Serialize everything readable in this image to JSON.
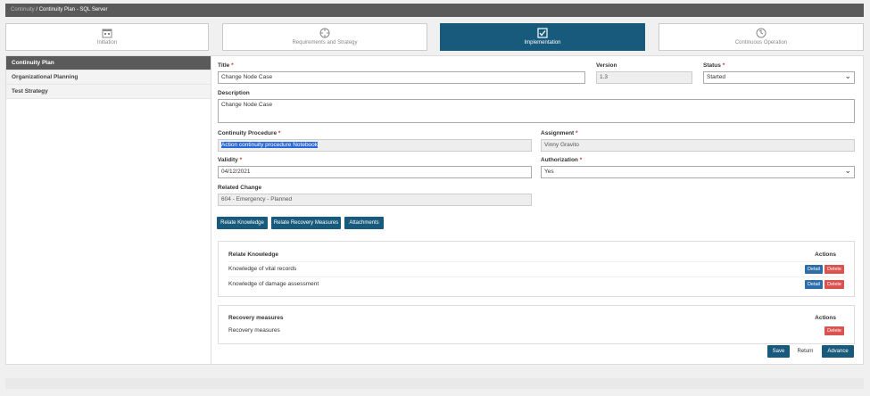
{
  "breadcrumb": {
    "parent": "Continuity",
    "separator": "/",
    "current": "Continuity Plan - SQL Server"
  },
  "steps": [
    {
      "label": "Initiation",
      "icon": "calendar-icon"
    },
    {
      "label": "Requirements and Strategy",
      "icon": "crosshair-icon"
    },
    {
      "label": "Implementation",
      "icon": "checkbox-icon"
    },
    {
      "label": "Continuous Operation",
      "icon": "refresh-icon"
    }
  ],
  "sidebar": {
    "items": [
      {
        "label": "Continuity Plan"
      },
      {
        "label": "Organizational Planning"
      },
      {
        "label": "Test Strategy"
      }
    ]
  },
  "form": {
    "title_label": "Title",
    "title_value": "Change Node Case",
    "version_label": "Version",
    "version_value": "1.3",
    "status_label": "Status",
    "status_value": "Started",
    "description_label": "Description",
    "description_value": "Change Node Case",
    "procedure_label": "Continuity Procedure",
    "procedure_value": "Action continuity procedure Notebook",
    "assignment_label": "Assignment",
    "assignment_value": "Vinny Gravito",
    "validity_label": "Validity",
    "validity_value": "04/12/2021",
    "authorization_label": "Authorization",
    "authorization_value": "Yes",
    "related_label": "Related Change",
    "related_value": "604 - Emergency - Planned",
    "required_mark": "*"
  },
  "actions": {
    "relate_knowledge": "Relate Knowledge",
    "relate_recovery": "Relate Recovery Measures",
    "attachments": "Attachments"
  },
  "knowledge": {
    "header": "Relate Knowledge",
    "actions_header": "Actions",
    "rows": [
      {
        "name": "Knowledge of vital records"
      },
      {
        "name": "Knowledge of damage assessment"
      }
    ],
    "detail_label": "Detail",
    "delete_label": "Delete"
  },
  "recovery": {
    "header": "Recovery measures",
    "actions_header": "Actions",
    "rows": [
      {
        "name": "Recovery measures"
      }
    ],
    "delete_label": "Delete"
  },
  "footer": {
    "save": "Save",
    "return": "Return",
    "advance": "Advance"
  },
  "colors": {
    "accent": "#185a7c",
    "danger": "#d9534f",
    "info": "#2d6ea8"
  }
}
